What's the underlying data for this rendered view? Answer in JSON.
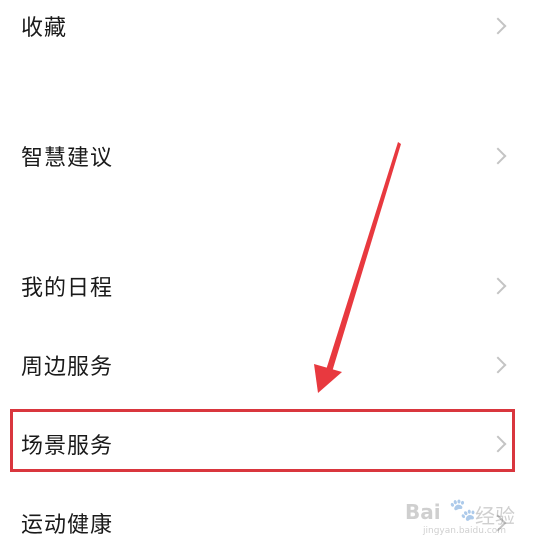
{
  "menu": {
    "items": [
      {
        "label": "收藏"
      },
      {
        "label": "智慧建议"
      },
      {
        "label": "我的日程"
      },
      {
        "label": "周边服务"
      },
      {
        "label": "场景服务"
      },
      {
        "label": "运动健康"
      }
    ],
    "highlighted_item": "场景服务"
  },
  "annotation": {
    "color": "#d9363e",
    "arrow_icon": "red-arrow-icon"
  },
  "watermark": {
    "logo": "Bai",
    "paw_icon": "paw-icon",
    "text": "经验",
    "url": "jingyan.baidu.com"
  }
}
